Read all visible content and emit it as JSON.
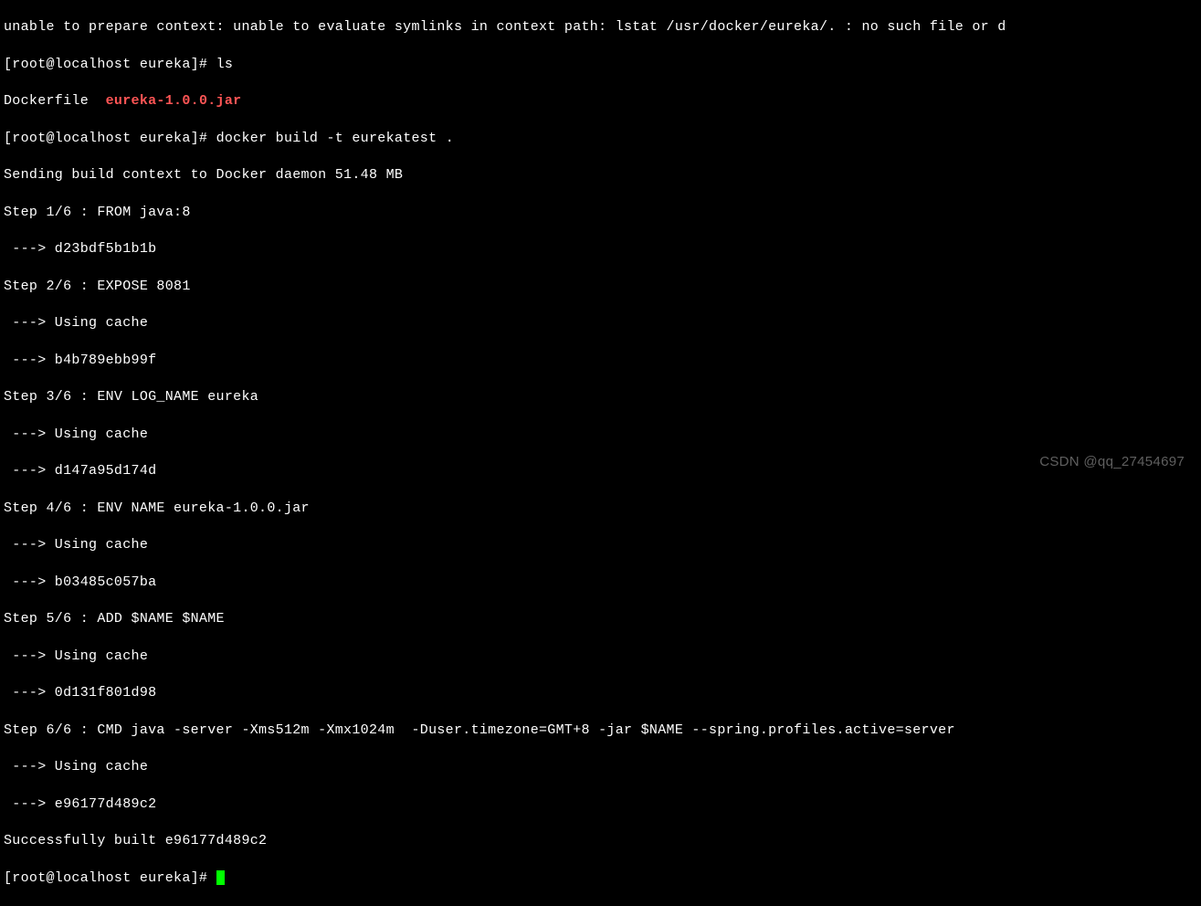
{
  "terminal": {
    "error_line": "unable to prepare context: unable to evaluate symlinks in context path: lstat /usr/docker/eureka/. : no such file or d",
    "prompt": "[root@localhost eureka]#",
    "commands": {
      "ls": "ls",
      "docker_build": "docker build -t eurekatest ."
    },
    "ls_output": {
      "file1": "Dockerfile",
      "file2": "eureka-1.0.0.jar"
    },
    "build_output": {
      "sending": "Sending build context to Docker daemon 51.48 MB",
      "step1": "Step 1/6 : FROM java:8",
      "step1_hash": " ---> d23bdf5b1b1b",
      "step2": "Step 2/6 : EXPOSE 8081",
      "step2_cache": " ---> Using cache",
      "step2_hash": " ---> b4b789ebb99f",
      "step3": "Step 3/6 : ENV LOG_NAME eureka",
      "step3_cache": " ---> Using cache",
      "step3_hash": " ---> d147a95d174d",
      "step4": "Step 4/6 : ENV NAME eureka-1.0.0.jar",
      "step4_cache": " ---> Using cache",
      "step4_hash": " ---> b03485c057ba",
      "step5": "Step 5/6 : ADD $NAME $NAME",
      "step5_cache": " ---> Using cache",
      "step5_hash": " ---> 0d131f801d98",
      "step6": "Step 6/6 : CMD java -server -Xms512m -Xmx1024m  -Duser.timezone=GMT+8 -jar $NAME --spring.profiles.active=server",
      "step6_cache": " ---> Using cache",
      "step6_hash": " ---> e96177d489c2",
      "success": "Successfully built e96177d489c2"
    }
  },
  "watermark": "CSDN @qq_27454697"
}
